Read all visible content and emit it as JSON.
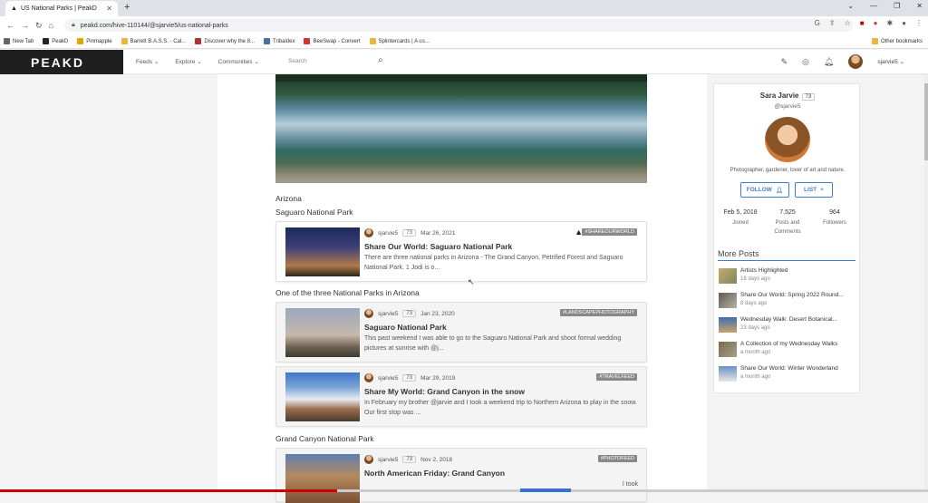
{
  "browser": {
    "tab_title": "US National Parks | PeakD",
    "url": "peakd.com/hive-110144/@sjarvie5/us-national-parks",
    "bookmarks": [
      "New Tab",
      "PeakD",
      "Pinmapple",
      "Barrett B.A.S.S. - Cal...",
      "Discover why the 8...",
      "Tribaldex",
      "BeeSwap - Convert",
      "Splintercards | A co..."
    ],
    "other_bookmarks": "Other bookmarks"
  },
  "nav": {
    "logo": "PEAKD",
    "links": [
      "Feeds",
      "Explore",
      "Communities"
    ],
    "search_placeholder": "Search",
    "user": "sjarvie5"
  },
  "sections": {
    "arizona": "Arizona",
    "saguaro": "Saguaro National Park",
    "one_of_three": "One of the three National Parks in Arizona",
    "grand_canyon": "Grand Canyon National Park"
  },
  "posts": [
    {
      "author": "sjarvie5",
      "rep": "73",
      "date": "Mar 26, 2021",
      "tag": "#SHAREOURWORLD",
      "title": "Share Our World: Saguaro National Park",
      "excerpt": "There are three national parks in Arizona - The Grand Canyon, Petrified Forest and Saguaro National Park. 1 Jodi is o..."
    },
    {
      "author": "sjarvie5",
      "rep": "73",
      "date": "Jan 23, 2020",
      "tag": "#LANDSCAPEPHOTOGRAPHY",
      "title": "Saguaro National Park",
      "excerpt": "This past weekend I was able to go to the Saguaro National Park and shoot formal wedding pictures at sunrise with @j..."
    },
    {
      "author": "sjarvie5",
      "rep": "73",
      "date": "Mar 29, 2019",
      "tag": "#TRAVELFEED",
      "title": "Share My World: Grand Canyon in the snow",
      "excerpt": "In February my brother @jarvie and I took a weekend trip to Northern Arizona to play in the snow. Our first stop was ..."
    },
    {
      "author": "sjarvie5",
      "rep": "73",
      "date": "Nov 2, 2018",
      "tag": "#PHOTOFEED",
      "title": "North American Friday: Grand Canyon",
      "excerpt": "I took"
    }
  ],
  "profile": {
    "name": "Sara Jarvie",
    "rep": "73",
    "handle": "@sjarvie5",
    "bio": "Photographer, gardener, lover of art and nature.",
    "follow": "FOLLOW",
    "list": "LIST",
    "joined_value": "Feb 5, 2018",
    "joined_label": "Joined",
    "posts_value": "7,525",
    "posts_label": "Posts and Comments",
    "followers_value": "964",
    "followers_label": "Followers"
  },
  "more_posts": {
    "heading": "More Posts",
    "items": [
      {
        "title": "Artists Highlighted",
        "age": "18 days ago"
      },
      {
        "title": "Share Our World: Spring 2022 Round...",
        "age": "8 days ago"
      },
      {
        "title": "Wednesday Walk: Desert Botanical...",
        "age": "23 days ago"
      },
      {
        "title": "A Collection of my Wednesday Walks",
        "age": "a month ago"
      },
      {
        "title": "Share Our World: Winter Wonderland",
        "age": "a month ago"
      }
    ]
  }
}
